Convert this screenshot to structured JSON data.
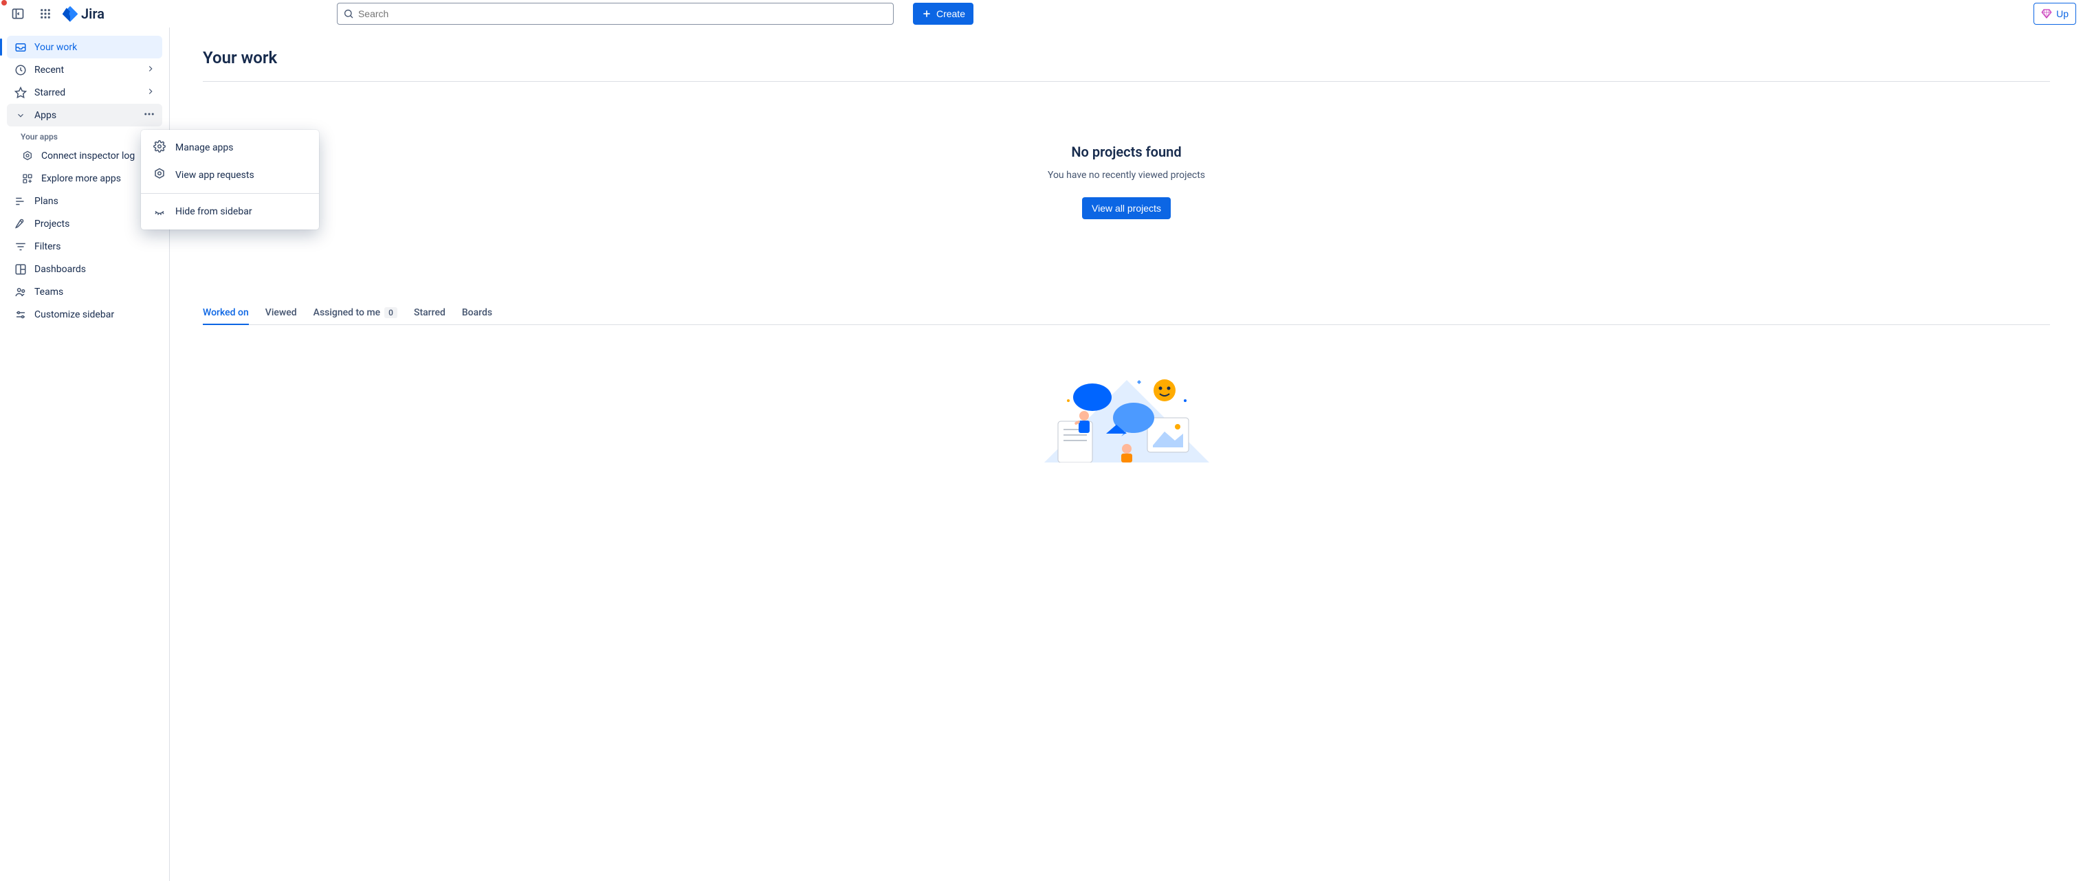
{
  "header": {
    "app_name": "Jira",
    "search_placeholder": "Search",
    "create_label": "Create",
    "upgrade_label": "Up"
  },
  "sidebar": {
    "items": [
      {
        "id": "your-work",
        "label": "Your work",
        "icon": "inbox"
      },
      {
        "id": "recent",
        "label": "Recent",
        "icon": "clock",
        "expandable": true
      },
      {
        "id": "starred",
        "label": "Starred",
        "icon": "star",
        "expandable": true
      },
      {
        "id": "apps",
        "label": "Apps",
        "icon": "chevron-down",
        "more": true
      },
      {
        "id": "plans",
        "label": "Plans",
        "icon": "plans"
      },
      {
        "id": "projects",
        "label": "Projects",
        "icon": "rocket"
      },
      {
        "id": "filters",
        "label": "Filters",
        "icon": "filter"
      },
      {
        "id": "dashboards",
        "label": "Dashboards",
        "icon": "dashboard"
      },
      {
        "id": "teams",
        "label": "Teams",
        "icon": "team"
      },
      {
        "id": "customize",
        "label": "Customize sidebar",
        "icon": "sliders"
      }
    ],
    "apps_section": {
      "heading": "Your apps",
      "items": [
        {
          "id": "connect-inspector",
          "label": "Connect inspector log",
          "icon": "hexagon"
        },
        {
          "id": "explore-more",
          "label": "Explore more apps",
          "icon": "apps-grid"
        }
      ]
    }
  },
  "popover": {
    "group1": [
      {
        "id": "manage-apps",
        "label": "Manage apps",
        "icon": "gear"
      },
      {
        "id": "view-requests",
        "label": "View app requests",
        "icon": "hexagon"
      }
    ],
    "group2": [
      {
        "id": "hide-sidebar",
        "label": "Hide from sidebar",
        "icon": "eye-off"
      }
    ]
  },
  "main": {
    "title": "Your work",
    "empty": {
      "title": "No projects found",
      "subtitle": "You have no recently viewed projects",
      "button": "View all projects"
    },
    "tabs": [
      {
        "id": "worked-on",
        "label": "Worked on",
        "active": true
      },
      {
        "id": "viewed",
        "label": "Viewed"
      },
      {
        "id": "assigned",
        "label": "Assigned to me",
        "badge": "0"
      },
      {
        "id": "starred",
        "label": "Starred"
      },
      {
        "id": "boards",
        "label": "Boards"
      }
    ]
  }
}
